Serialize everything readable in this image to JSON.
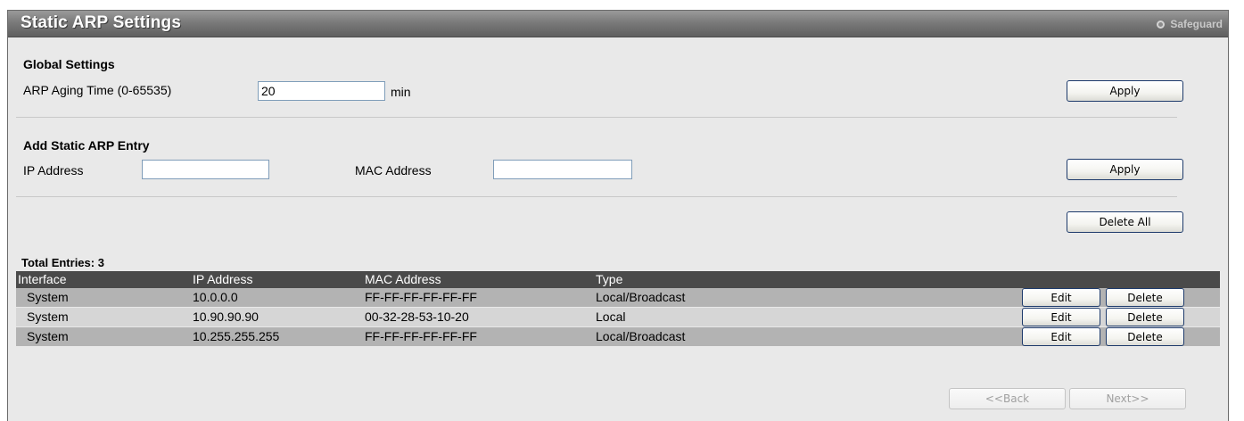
{
  "window": {
    "title": "Static ARP Settings",
    "safeguard_label": "Safeguard"
  },
  "global_settings": {
    "heading": "Global Settings",
    "aging_label": "ARP Aging Time (0-65535)",
    "aging_value": "20",
    "aging_unit": "min",
    "apply_label": "Apply"
  },
  "add_entry": {
    "heading": "Add Static ARP Entry",
    "ip_label": "IP Address",
    "ip_value": "",
    "mac_label": "MAC Address",
    "mac_value": "",
    "apply_label": "Apply"
  },
  "delete_all_label": "Delete All",
  "table": {
    "total_entries": "Total Entries: 3",
    "columns": [
      "Interface",
      "IP Address",
      "MAC Address",
      "Type"
    ],
    "rows": [
      {
        "interface": "System",
        "ip": "10.0.0.0",
        "mac": "FF-FF-FF-FF-FF-FF",
        "type": "Local/Broadcast",
        "edit": "Edit",
        "delete": "Delete"
      },
      {
        "interface": "System",
        "ip": "10.90.90.90",
        "mac": "00-32-28-53-10-20",
        "type": "Local",
        "edit": "Edit",
        "delete": "Delete"
      },
      {
        "interface": "System",
        "ip": "10.255.255.255",
        "mac": "FF-FF-FF-FF-FF-FF",
        "type": "Local/Broadcast",
        "edit": "Edit",
        "delete": "Delete"
      }
    ]
  },
  "pagination": {
    "back_label": "<<Back",
    "next_label": "Next>>"
  }
}
